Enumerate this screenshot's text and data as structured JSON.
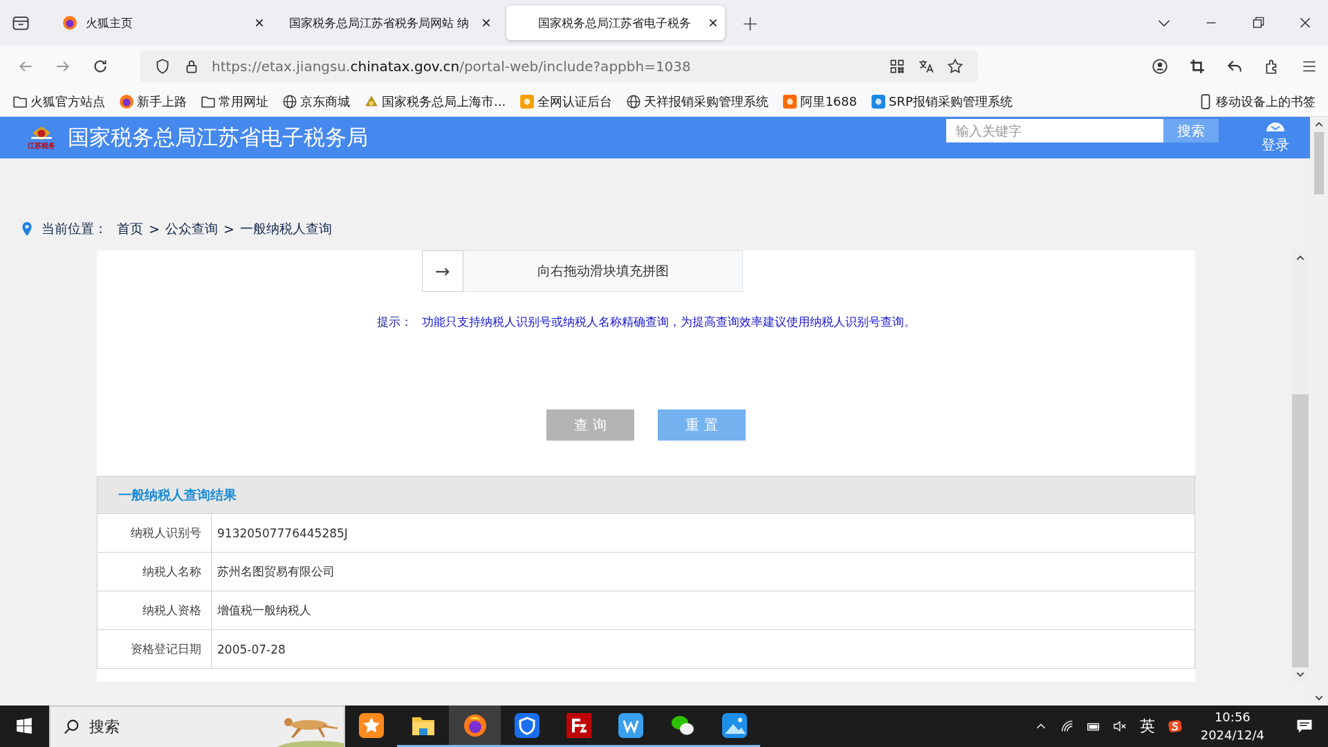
{
  "browser": {
    "tabs": [
      {
        "title": "火狐主页",
        "kind": "firefox",
        "selected": false
      },
      {
        "title": "国家税务总局江苏省税务局网站 纳",
        "kind": "plain",
        "selected": false
      },
      {
        "title": "国家税务总局江苏省电子税务",
        "kind": "plain",
        "selected": true
      }
    ],
    "new_tab": "+",
    "url": {
      "prefix": "https://etax.jiangsu.",
      "domain": "chinatax.gov.cn",
      "suffix": "/portal-web/include?appbh=1038"
    },
    "bookmarks": [
      {
        "label": "火狐官方站点",
        "kind": "folder"
      },
      {
        "label": "新手上路",
        "kind": "firefox"
      },
      {
        "label": "常用网址",
        "kind": "folder"
      },
      {
        "label": "京东商城",
        "kind": "globe"
      },
      {
        "label": "国家税务总局上海市...",
        "kind": "emblem"
      },
      {
        "label": "全网认证后台",
        "kind": "tile",
        "color": "#f5a000"
      },
      {
        "label": "天祥报销采购管理系统",
        "kind": "globe"
      },
      {
        "label": "阿里1688",
        "kind": "tile",
        "color": "#ff6a00"
      },
      {
        "label": "SRP报销采购管理系统",
        "kind": "tile",
        "color": "#1e88e5"
      }
    ],
    "mobile_bookmarks": "移动设备上的书签"
  },
  "site_header": {
    "logo_caption": "江苏税务",
    "title": "国家税务总局江苏省电子税务局",
    "search": {
      "placeholder": "输入关键字",
      "button": "搜索"
    },
    "login": "登录"
  },
  "breadcrumb": {
    "label": "当前位置：",
    "items": [
      "首页",
      "公众查询",
      "一般纳税人查询"
    ],
    "separator": ">"
  },
  "captcha": {
    "arrow": "→",
    "text": "向右拖动滑块填充拼图"
  },
  "hint": {
    "label": "提示：",
    "text": "功能只支持纳税人识别号或纳税人名称精确查询，为提高查询效率建议使用纳税人识别号查询。"
  },
  "buttons": [
    {
      "label": "查 询",
      "kind": "query"
    },
    {
      "label": "重 置",
      "kind": "reset"
    }
  ],
  "results": {
    "title": "一般纳税人查询结果",
    "rows": [
      {
        "label": "纳税人识别号",
        "value": "91320507776445285J"
      },
      {
        "label": "纳税人名称",
        "value": "苏州名图贸易有限公司"
      },
      {
        "label": "纳税人资格",
        "value": "增值税一般纳税人"
      },
      {
        "label": "资格登记日期",
        "value": "2005-07-28"
      }
    ]
  },
  "taskbar": {
    "search": "搜索",
    "apps": [
      {
        "kind": "star",
        "selected": false,
        "running": false
      },
      {
        "kind": "folder",
        "selected": false,
        "running": true
      },
      {
        "kind": "firefox",
        "selected": true,
        "running": true
      },
      {
        "kind": "shield",
        "selected": false,
        "running": true
      },
      {
        "kind": "filezilla",
        "selected": false,
        "running": true
      },
      {
        "kind": "w",
        "selected": false,
        "running": true
      },
      {
        "kind": "wechat",
        "selected": false,
        "running": true
      },
      {
        "kind": "photos",
        "selected": false,
        "running": true
      }
    ],
    "ime": "英",
    "time": "10:56",
    "date": "2024/12/4"
  }
}
